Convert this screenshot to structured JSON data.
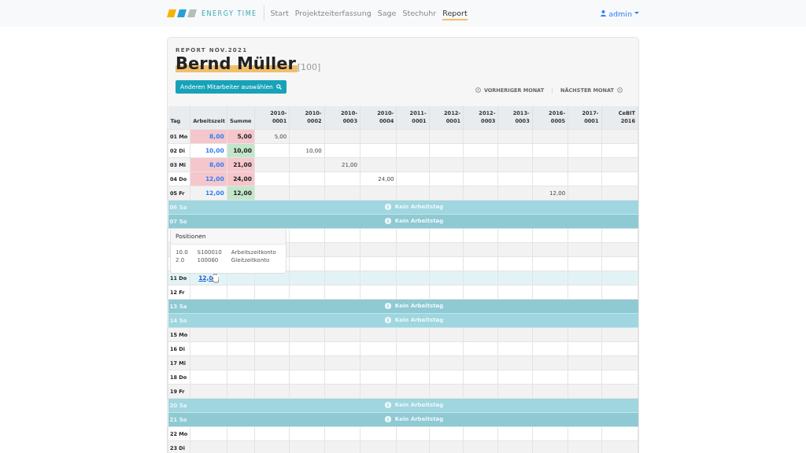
{
  "navbar": {
    "brand": "ENERGY TIME",
    "links": [
      {
        "label": "Start",
        "selected": false
      },
      {
        "label": "Projektzeiterfassung",
        "selected": false
      },
      {
        "label": "Sage",
        "selected": false
      },
      {
        "label": "Stechuhr",
        "selected": false
      },
      {
        "label": "Report",
        "selected": true
      }
    ],
    "user": "admin"
  },
  "report": {
    "subtitle": "REPORT NOV.2021",
    "name": "Bernd Müller",
    "id": "[100]",
    "select_button": "Anderen Mitarbeiter auswählen",
    "prev": "VORHERIGER MONAT",
    "next": "NÄCHSTER MONAT"
  },
  "table": {
    "columns": [
      {
        "label": "Tag"
      },
      {
        "label": "Arbeitszeit"
      },
      {
        "label": "Summe"
      },
      {
        "label": "2010-0001"
      },
      {
        "label": "2010-0002"
      },
      {
        "label": "2010-0003"
      },
      {
        "label": "2010-0004"
      },
      {
        "label": "2011-0001"
      },
      {
        "label": "2012-0001"
      },
      {
        "label": "2012-0003"
      },
      {
        "label": "2013-0003"
      },
      {
        "label": "2016-0005"
      },
      {
        "label": "2017-0001"
      },
      {
        "label": "CeBIT 2016"
      }
    ],
    "rows": [
      {
        "kind": "day",
        "tag": "01 Mo",
        "highlighted": false,
        "work": {
          "text": "8,00",
          "flagged": true
        },
        "sum": {
          "text": "5,00",
          "balanced": false
        },
        "cells": [
          "5,00",
          null,
          null,
          null,
          null,
          null,
          null,
          null,
          null,
          null,
          null
        ]
      },
      {
        "kind": "day",
        "tag": "02 Di",
        "highlighted": false,
        "work": {
          "text": "10,00",
          "flagged": false
        },
        "sum": {
          "text": "10,00",
          "balanced": true
        },
        "cells": [
          null,
          "10,00",
          null,
          null,
          null,
          null,
          null,
          null,
          null,
          null,
          null
        ]
      },
      {
        "kind": "day",
        "tag": "03 Mi",
        "highlighted": false,
        "work": {
          "text": "8,00",
          "flagged": true
        },
        "sum": {
          "text": "21,00",
          "balanced": false
        },
        "cells": [
          null,
          null,
          "21,00",
          null,
          null,
          null,
          null,
          null,
          null,
          null,
          null
        ]
      },
      {
        "kind": "day",
        "tag": "04 Do",
        "highlighted": false,
        "work": {
          "text": "12,00",
          "flagged": true
        },
        "sum": {
          "text": "24,00",
          "balanced": false
        },
        "cells": [
          null,
          null,
          null,
          "24,00",
          null,
          null,
          null,
          null,
          null,
          null,
          null
        ]
      },
      {
        "kind": "day",
        "tag": "05 Fr",
        "highlighted": false,
        "work": {
          "text": "12,00",
          "flagged": false
        },
        "sum": {
          "text": "12,00",
          "balanced": true
        },
        "cells": [
          null,
          null,
          null,
          null,
          null,
          null,
          null,
          null,
          "12,00",
          null,
          null
        ]
      },
      {
        "kind": "off",
        "tag": "06 Sa",
        "note": "Kein Arbeitstag"
      },
      {
        "kind": "off",
        "tag": "07 So",
        "note": "Kein Arbeitstag"
      },
      {
        "kind": "day",
        "highlighted": false,
        "cells": [
          null,
          null,
          null,
          null,
          null,
          null,
          null,
          null,
          null,
          null,
          null
        ]
      },
      {
        "kind": "day",
        "highlighted": false,
        "cells": [
          null,
          null,
          null,
          null,
          null,
          null,
          null,
          null,
          null,
          null,
          null
        ]
      },
      {
        "kind": "day",
        "highlighted": false,
        "cells": [
          null,
          null,
          null,
          null,
          null,
          null,
          null,
          null,
          null,
          null,
          null
        ]
      },
      {
        "kind": "day",
        "tag": "11 Do",
        "highlighted": true,
        "work": {
          "text": "12,0",
          "link": true,
          "flagged": false
        },
        "cells": [
          null,
          null,
          null,
          null,
          null,
          null,
          null,
          null,
          null,
          null,
          null
        ]
      },
      {
        "kind": "day",
        "tag": "12 Fr",
        "highlighted": false,
        "cells": [
          null,
          null,
          null,
          null,
          null,
          null,
          null,
          null,
          null,
          null,
          null
        ]
      },
      {
        "kind": "off",
        "tag": "13 Sa",
        "note": "Kein Arbeitstag"
      },
      {
        "kind": "off",
        "tag": "14 So",
        "note": "Kein Arbeitstag"
      },
      {
        "kind": "day",
        "tag": "15 Mo",
        "highlighted": false,
        "cells": [
          null,
          null,
          null,
          null,
          null,
          null,
          null,
          null,
          null,
          null,
          null
        ]
      },
      {
        "kind": "day",
        "tag": "16 Di",
        "highlighted": false,
        "cells": [
          null,
          null,
          null,
          null,
          null,
          null,
          null,
          null,
          null,
          null,
          null
        ]
      },
      {
        "kind": "day",
        "tag": "17 Mi",
        "highlighted": false,
        "cells": [
          null,
          null,
          null,
          null,
          null,
          null,
          null,
          null,
          null,
          null,
          null
        ]
      },
      {
        "kind": "day",
        "tag": "18 Do",
        "highlighted": false,
        "cells": [
          null,
          null,
          null,
          null,
          null,
          null,
          null,
          null,
          null,
          null,
          null
        ]
      },
      {
        "kind": "day",
        "tag": "19 Fr",
        "highlighted": false,
        "cells": [
          null,
          null,
          null,
          null,
          null,
          null,
          null,
          null,
          null,
          null,
          null
        ]
      },
      {
        "kind": "off",
        "tag": "20 Sa",
        "note": "Kein Arbeitstag"
      },
      {
        "kind": "off",
        "tag": "21 So",
        "note": "Kein Arbeitstag"
      },
      {
        "kind": "day",
        "tag": "22 Mo",
        "highlighted": false,
        "cells": [
          null,
          null,
          null,
          null,
          null,
          null,
          null,
          null,
          null,
          null,
          null
        ]
      },
      {
        "kind": "day",
        "tag": "23 Di",
        "highlighted": false,
        "cells": [
          null,
          null,
          null,
          null,
          null,
          null,
          null,
          null,
          null,
          null,
          null
        ]
      }
    ]
  },
  "popover": {
    "title": "Positionen",
    "lines": [
      {
        "amount": "10.0",
        "code": "S100010",
        "account": "Arbeitszeitkonto"
      },
      {
        "amount": "2.0",
        "code": "100060",
        "account": "Gleitzeitkonto"
      }
    ]
  }
}
